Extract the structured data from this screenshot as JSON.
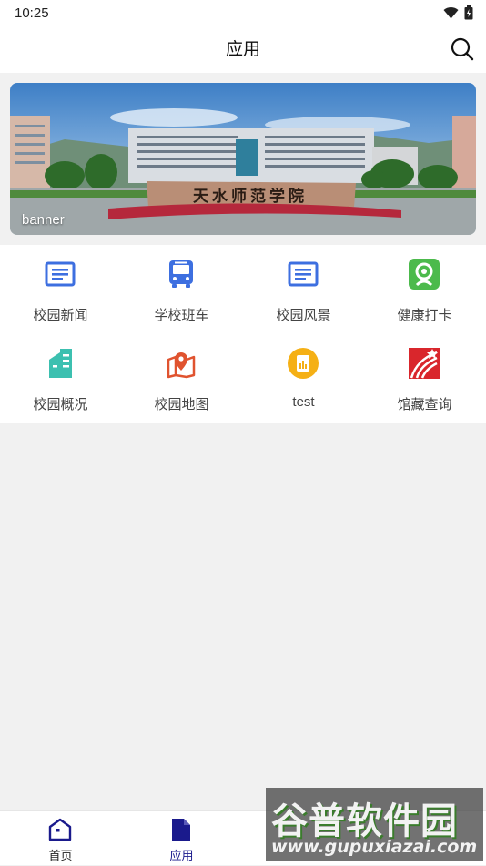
{
  "status_bar": {
    "time": "10:25"
  },
  "header": {
    "title": "应用"
  },
  "banner": {
    "caption": "banner",
    "sign_text": "天水师范学院"
  },
  "apps": [
    {
      "label": "校园新闻",
      "icon": "news-icon",
      "color": "#3d6fe0"
    },
    {
      "label": "学校班车",
      "icon": "bus-icon",
      "color": "#3d6fe0"
    },
    {
      "label": "校园风景",
      "icon": "scenery-icon",
      "color": "#3d6fe0"
    },
    {
      "label": "健康打卡",
      "icon": "health-checkin-icon",
      "color": "#4cba4c"
    },
    {
      "label": "校园概况",
      "icon": "building-icon",
      "color": "#3cc0b0"
    },
    {
      "label": "校园地图",
      "icon": "map-pin-icon",
      "color": "#e0532f"
    },
    {
      "label": "test",
      "icon": "test-icon",
      "color": "#f5b015"
    },
    {
      "label": "馆藏查询",
      "icon": "library-icon",
      "color": "#d9262c"
    }
  ],
  "bottom_nav": {
    "items": [
      {
        "label": "首页",
        "icon": "home-icon",
        "active": false
      },
      {
        "label": "应用",
        "icon": "apps-icon",
        "active": true
      }
    ],
    "active_color": "#1a1a8c"
  },
  "watermark": {
    "title": "谷普软件园",
    "url": "www.gupuxiazai.com"
  }
}
